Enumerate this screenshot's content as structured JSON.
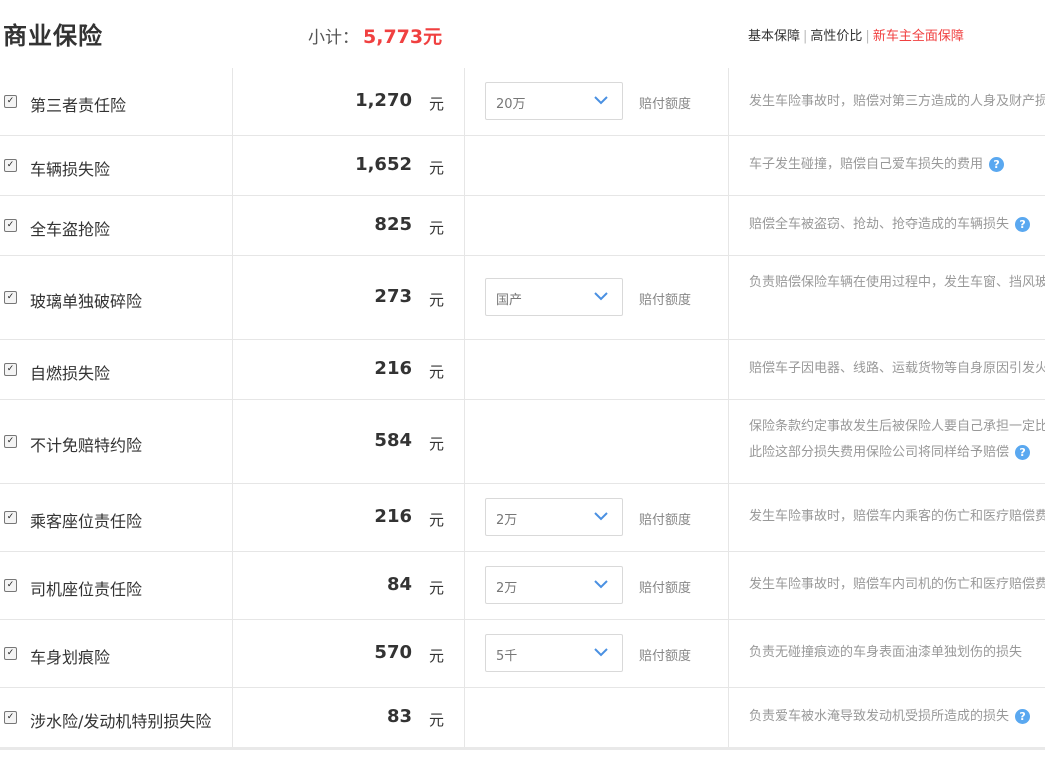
{
  "header": {
    "title": "商业保险",
    "subtotal_label": "小计：",
    "subtotal_value": "5,773元",
    "plans": [
      "基本保障",
      "高性价比",
      "新车主全面保障"
    ]
  },
  "rows": [
    {
      "name": "第三者责任险",
      "price": "1,270",
      "unit": "元",
      "option": "20万",
      "option_label": "赔付额度",
      "desc": "发生车险事故时，赔偿对第三方造成的人身及财产损失"
    },
    {
      "name": "车辆损失险",
      "price": "1,652",
      "unit": "元",
      "desc": "车子发生碰撞，赔偿自己爱车损失的费用"
    },
    {
      "name": "全车盗抢险",
      "price": "825",
      "unit": "元",
      "desc": "赔偿全车被盗窃、抢劫、抢夺造成的车辆损失"
    },
    {
      "name": "玻璃单独破碎险",
      "price": "273",
      "unit": "元",
      "option": "国产",
      "option_label": "赔付额度",
      "desc": "负责赔偿保险车辆在使用过程中，发生车窗、挡风玻璃单独破碎"
    },
    {
      "name": "自燃损失险",
      "price": "216",
      "unit": "元",
      "desc": "赔偿车子因电器、线路、运载货物等自身原因引发火灾"
    },
    {
      "name": "不计免赔特约险",
      "price": "584",
      "unit": "元",
      "desc": "保险条款约定事故发生后被保险人要自己承担一定比例损失，",
      "desc2": "此险这部分损失费用保险公司将同样给予赔偿"
    },
    {
      "name": "乘客座位责任险",
      "price": "216",
      "unit": "元",
      "option": "2万",
      "option_label": "赔付额度",
      "desc": "发生车险事故时，赔偿车内乘客的伤亡和医疗赔偿费用"
    },
    {
      "name": "司机座位责任险",
      "price": "84",
      "unit": "元",
      "option": "2万",
      "option_label": "赔付额度",
      "desc": "发生车险事故时，赔偿车内司机的伤亡和医疗赔偿费用"
    },
    {
      "name": "车身划痕险",
      "price": "570",
      "unit": "元",
      "option": "5千",
      "option_label": "赔付额度",
      "desc": "负责无碰撞痕迹的车身表面油漆单独划伤的损失"
    },
    {
      "name": "涉水险/发动机特别损失险",
      "price": "83",
      "unit": "元",
      "desc": "负责爱车被水淹导致发动机受损所造成的损失"
    }
  ]
}
